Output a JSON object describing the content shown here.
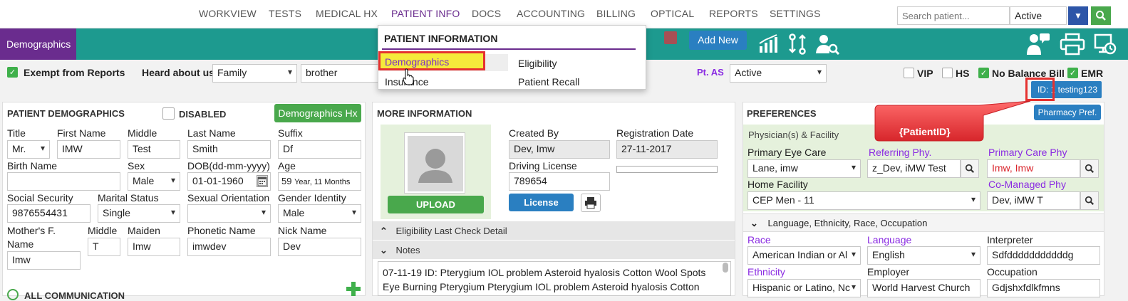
{
  "nav": [
    "WORKVIEW",
    "TESTS",
    "MEDICAL HX",
    "PATIENT INFO",
    "DOCS",
    "ACCOUNTING",
    "BILLING",
    "OPTICAL",
    "REPORTS",
    "SETTINGS"
  ],
  "search": {
    "placeholder": "Search patient...",
    "status": "Active"
  },
  "tabs": {
    "demographics": "Demographics",
    "add_new": "Add New"
  },
  "dropdown": {
    "title": "PATIENT INFORMATION",
    "items": [
      "Demographics",
      "Eligibility",
      "Insurance",
      "Patient Recall"
    ]
  },
  "row2": {
    "exempt": "Exempt from Reports",
    "heard_label": "Heard about us",
    "heard_value": "Family",
    "heard_detail": "brother",
    "pt_as_label": "Pt. AS",
    "pt_as_value": "Active",
    "vip": "VIP",
    "hs": "HS",
    "nobal": "No Balance Bill",
    "emr": "EMR",
    "patient_id": "ID: 1 testing123"
  },
  "demographics": {
    "title": "PATIENT DEMOGRAPHICS",
    "disabled": "DISABLED",
    "hx_button": "Demographics Hx",
    "labels": {
      "title": "Title",
      "first": "First Name",
      "middle": "Middle",
      "last": "Last Name",
      "suffix": "Suffix",
      "birth_name": "Birth Name",
      "sex": "Sex",
      "dob": "DOB(dd-mm-yyyy)",
      "age": "Age",
      "ssn": "Social Security",
      "marital": "Marital Status",
      "orientation": "Sexual Orientation",
      "gender": "Gender Identity",
      "mothers": "Mother's F.",
      "mothers2": "Name",
      "m_middle": "Middle",
      "maiden": "Maiden",
      "phonetic": "Phonetic Name",
      "nick": "Nick Name",
      "communication": "ALL COMMUNICATION"
    },
    "values": {
      "title": "Mr.",
      "first": "IMW",
      "middle": "Test",
      "last": "Smith",
      "suffix": "Df",
      "birth_name": "",
      "sex": "Male",
      "dob": "01-01-1960",
      "age": "59",
      "age_unit": "Year, 11 Months",
      "ssn": "9876554431",
      "marital": "Single",
      "orientation": "",
      "gender": "Male",
      "mothers": "Imw",
      "m_middle": "T",
      "maiden": "Imw",
      "phonetic": "imwdev",
      "nick": "Dev"
    }
  },
  "more_info": {
    "title": "MORE INFORMATION",
    "upload": "UPLOAD",
    "created_by_label": "Created By",
    "created_by": "Dev, Imw",
    "reg_date_label": "Registration Date",
    "reg_date": "27-11-2017",
    "dl_label": "Driving License",
    "dl": "789654",
    "license_button": "License",
    "eligibility": "Eligibility Last Check Detail",
    "notes": "Notes",
    "notes_text1": "07-11-19 ID: Pterygium IOL problem Asteroid hyalosis Cotton Wool Spots",
    "notes_text2": "Eye Burning Pterygium Pterygium IOL problem Asteroid hyalosis Cotton"
  },
  "preferences": {
    "title": "PREFERENCES",
    "pharmacy": "Pharmacy Pref.",
    "callout": "{PatientID}",
    "physicians": "Physician(s) & Facility",
    "primary_eye_label": "Primary Eye Care",
    "primary_eye": "Lane, imw",
    "referring_label": "Referring Phy.",
    "referring": "z_Dev, iMW Test",
    "pcp_label": "Primary Care Phy",
    "pcp": "Imw, Imw",
    "home_label": "Home Facility",
    "home": "CEP Men - 11",
    "comanaged_label": "Co-Managed Phy",
    "comanaged": "Dev, iMW T",
    "lang_section": "Language, Ethnicity, Race, Occupation",
    "race_label": "Race",
    "race": "American Indian or Al",
    "language_label": "Language",
    "language": "English",
    "interpreter_label": "Interpreter",
    "interpreter": "Sdfdddddddddddg",
    "ethnicity_label": "Ethnicity",
    "ethnicity": "Hispanic or Latino, Nc",
    "employer_label": "Employer",
    "employer": "World Harvest Church",
    "occupation_label": "Occupation",
    "occupation": "Gdjshxfdlkfmns"
  },
  "colors": {
    "purple": "#6a2c8e",
    "teal": "#1d9a8f",
    "green": "#49a84c",
    "blue": "#2a7fc1",
    "red": "#e5312f"
  }
}
